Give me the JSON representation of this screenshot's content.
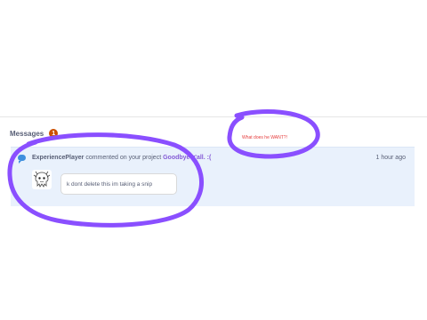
{
  "messages": {
    "title": "Messages",
    "count": "1"
  },
  "notification": {
    "icon": "comment-icon",
    "username": "ExperiencePlayer",
    "action_text": "commented on your project",
    "project_title": "Goodbye y'all. :(",
    "timestamp": "1 hour ago",
    "comment_text": "k dont delete this im taking a snip"
  },
  "annotation": {
    "text": "What does he WANT?!",
    "text_color": "#e53b3b",
    "scribble_color": "#8a4fff"
  },
  "colors": {
    "badge": "#cc4f00",
    "row_background": "#e9f1fc",
    "link": "#855cd6",
    "text": "#575e75"
  }
}
